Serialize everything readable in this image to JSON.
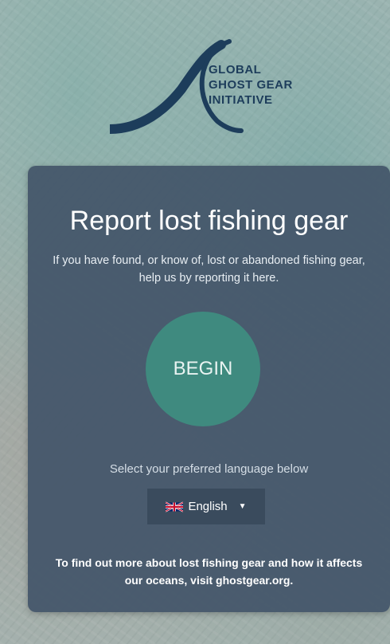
{
  "logo": {
    "line1": "GLOBAL",
    "line2": "GHOST GEAR",
    "line3": "INITIATIVE"
  },
  "card": {
    "title": "Report lost fishing gear",
    "subtitle": "If you have found, or know of, lost or abandoned fishing gear, help us by reporting it here.",
    "begin_label": "BEGIN",
    "language_prompt": "Select your preferred language below",
    "language_selected": "English",
    "footer": "To find out more about lost fishing gear and how it affects our oceans, visit ghostgear.org."
  },
  "colors": {
    "card_bg": "#44566a",
    "begin_button": "#3f8a7f",
    "logo_navy": "#1d3d5b"
  },
  "icons": {
    "flag": "uk-flag-icon",
    "dropdown": "caret-down-icon"
  }
}
